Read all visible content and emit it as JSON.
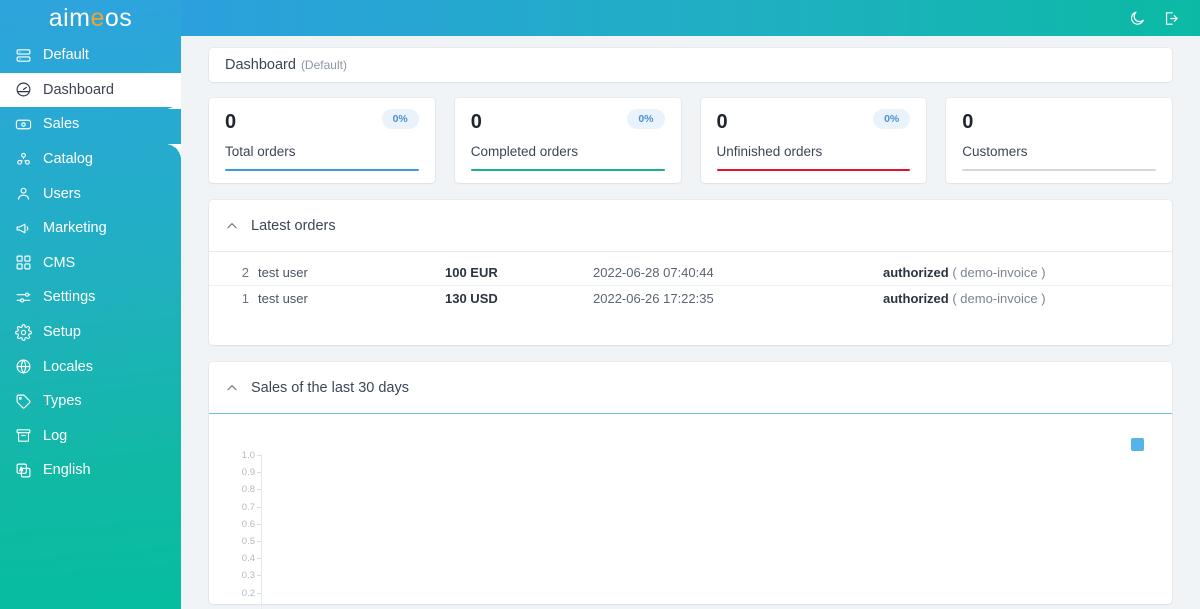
{
  "brand": {
    "before": "aim",
    "accent": "e",
    "after": "os"
  },
  "topbar": {
    "darkmode_label": "Dark mode",
    "logout_label": "Logout"
  },
  "sidebar": {
    "items": [
      {
        "label": "Default",
        "icon": "server-icon",
        "active": false
      },
      {
        "label": "Dashboard",
        "icon": "gauge-icon",
        "active": true
      },
      {
        "label": "Sales",
        "icon": "banknote-icon",
        "active": false
      },
      {
        "label": "Catalog",
        "icon": "catalog-icon",
        "active": false
      },
      {
        "label": "Users",
        "icon": "user-icon",
        "active": false
      },
      {
        "label": "Marketing",
        "icon": "megaphone-icon",
        "active": false
      },
      {
        "label": "CMS",
        "icon": "grid-icon",
        "active": false
      },
      {
        "label": "Settings",
        "icon": "sliders-icon",
        "active": false
      },
      {
        "label": "Setup",
        "icon": "gear-icon",
        "active": false
      },
      {
        "label": "Locales",
        "icon": "globe-icon",
        "active": false
      },
      {
        "label": "Types",
        "icon": "tag-icon",
        "active": false
      },
      {
        "label": "Log",
        "icon": "archive-icon",
        "active": false
      },
      {
        "label": "English",
        "icon": "translate-icon",
        "active": false
      }
    ]
  },
  "page": {
    "title": "Dashboard",
    "subtitle": "(Default)"
  },
  "stats": [
    {
      "value": "0",
      "label": "Total orders",
      "percent": "0%",
      "bar_color": "#3b9cdb"
    },
    {
      "value": "0",
      "label": "Completed orders",
      "percent": "0%",
      "bar_color": "#19b18c"
    },
    {
      "value": "0",
      "label": "Unfinished orders",
      "percent": "0%",
      "bar_color": "#e3112c"
    },
    {
      "value": "0",
      "label": "Customers",
      "percent": "",
      "bar_color": "#d4d8dd"
    }
  ],
  "latest_orders": {
    "title": "Latest orders",
    "rows": [
      {
        "id": "2",
        "customer": "test user",
        "amount": "100 EUR",
        "date": "2022-06-28 07:40:44",
        "status": "authorized",
        "service": "( demo-invoice )"
      },
      {
        "id": "1",
        "customer": "test user",
        "amount": "130 USD",
        "date": "2022-06-26 17:22:35",
        "status": "authorized",
        "service": "( demo-invoice )"
      }
    ]
  },
  "chart_data": {
    "type": "line",
    "title": "Sales of the last 30 days",
    "x": [],
    "series": [
      {
        "name": "",
        "values": [],
        "color": "#56b4e9"
      }
    ],
    "ylabel": "",
    "xlabel": "",
    "yticks": [
      "1.0",
      "0.9",
      "0.8",
      "0.7",
      "0.6",
      "0.5",
      "0.4",
      "0.3",
      "0.2"
    ],
    "ylim": [
      0,
      1
    ],
    "grid": false,
    "legend_position": "top-right",
    "legend_color": "#56b4e9",
    "empty": true
  }
}
